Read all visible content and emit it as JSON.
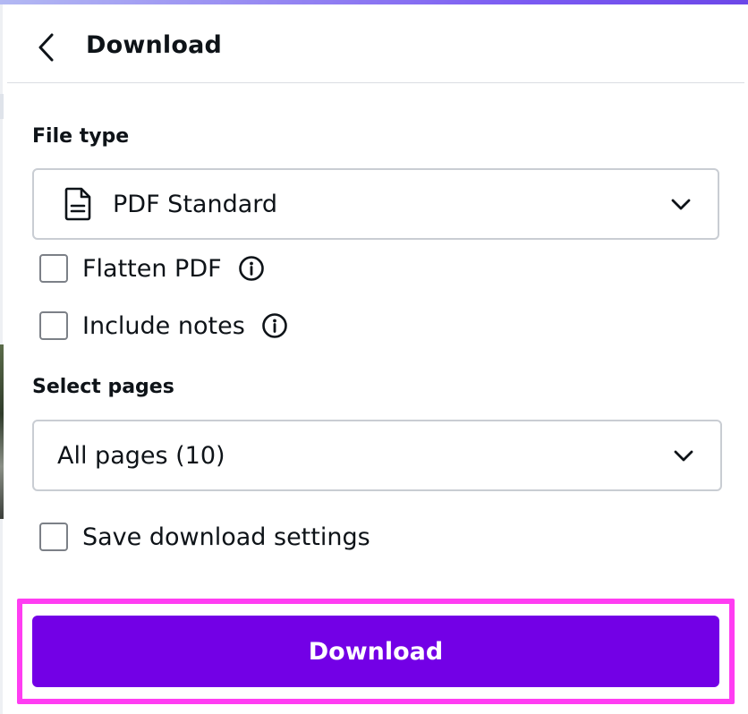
{
  "header": {
    "title": "Download",
    "back_icon": "chevron-left-icon"
  },
  "file_type": {
    "label": "File type",
    "selected": "PDF Standard",
    "icon": "document-icon",
    "options": {
      "flatten_pdf": {
        "label": "Flatten PDF",
        "checked": false,
        "info_icon": "info-icon"
      },
      "include_notes": {
        "label": "Include notes",
        "checked": false,
        "info_icon": "info-icon"
      }
    }
  },
  "select_pages": {
    "label": "Select pages",
    "selected": "All pages (10)"
  },
  "save_settings": {
    "label": "Save download settings",
    "checked": false
  },
  "download_button": {
    "label": "Download"
  },
  "colors": {
    "accent": "#7300e6",
    "highlight_outline": "#ff3df2",
    "text": "#0e1318",
    "border": "#c9cdd3"
  }
}
